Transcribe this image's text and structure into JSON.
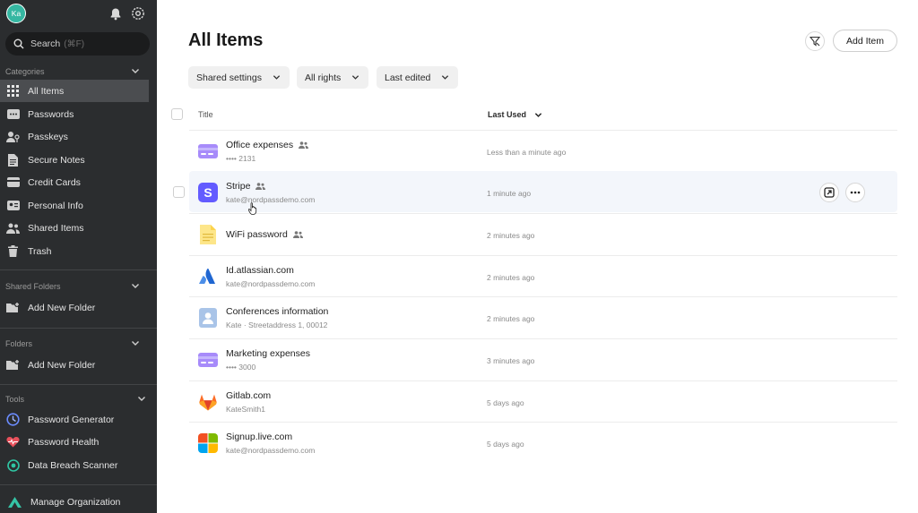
{
  "user": {
    "initials": "Ka"
  },
  "search": {
    "label": "Search",
    "shortcut": "(⌘F)"
  },
  "categories": {
    "heading": "Categories",
    "items": [
      {
        "label": "All Items",
        "icon": "grid-icon",
        "active": true
      },
      {
        "label": "Passwords",
        "icon": "password-icon"
      },
      {
        "label": "Passkeys",
        "icon": "passkey-icon"
      },
      {
        "label": "Secure Notes",
        "icon": "note-icon"
      },
      {
        "label": "Credit Cards",
        "icon": "card-icon"
      },
      {
        "label": "Personal Info",
        "icon": "id-card-icon"
      },
      {
        "label": "Shared Items",
        "icon": "users-icon"
      },
      {
        "label": "Trash",
        "icon": "trash-icon"
      }
    ]
  },
  "shared_folders": {
    "heading": "Shared Folders",
    "add_label": "Add New Folder"
  },
  "folders": {
    "heading": "Folders",
    "add_label": "Add New Folder"
  },
  "tools": {
    "heading": "Tools",
    "items": [
      {
        "label": "Password Generator",
        "icon": "generator-icon"
      },
      {
        "label": "Password Health",
        "icon": "heart-pulse-icon"
      },
      {
        "label": "Data Breach Scanner",
        "icon": "breach-scanner-icon"
      }
    ]
  },
  "manage_org": {
    "label": "Manage Organization"
  },
  "main": {
    "title": "All Items",
    "add_item_label": "Add Item",
    "filters": {
      "shared": "Shared settings",
      "rights": "All rights",
      "sort": "Last edited"
    },
    "columns": {
      "title": "Title",
      "last_used": "Last Used"
    }
  },
  "items": [
    {
      "title": "Office expenses",
      "subtitle": "•••• 2131",
      "time": "Less than a minute ago",
      "shared": true,
      "icon": "credit-card-icon"
    },
    {
      "title": "Stripe",
      "subtitle": "kate@nordpassdemo.com",
      "time": "1 minute ago",
      "shared": true,
      "icon": "stripe-logo-icon"
    },
    {
      "title": "WiFi password",
      "subtitle": "",
      "time": "2 minutes ago",
      "shared": true,
      "icon": "secure-note-icon"
    },
    {
      "title": "Id.atlassian.com",
      "subtitle": "kate@nordpassdemo.com",
      "time": "2 minutes ago",
      "shared": false,
      "icon": "atlassian-logo-icon"
    },
    {
      "title": "Conferences information",
      "subtitle": "Kate · Streetaddress 1, 00012",
      "time": "2 minutes ago",
      "shared": false,
      "icon": "personal-info-icon"
    },
    {
      "title": "Marketing expenses",
      "subtitle": "•••• 3000",
      "time": "3 minutes ago",
      "shared": false,
      "icon": "credit-card-icon"
    },
    {
      "title": "Gitlab.com",
      "subtitle": "KateSmith1",
      "time": "5 days ago",
      "shared": false,
      "icon": "gitlab-logo-icon"
    },
    {
      "title": "Signup.live.com",
      "subtitle": "kate@nordpassdemo.com",
      "time": "5 days ago",
      "shared": false,
      "icon": "microsoft-logo-icon"
    }
  ],
  "colors": {
    "sidebar_bg": "#2b2d2f",
    "active_bg": "#4b4d50",
    "avatar": "#35b7a2",
    "card_purple": "#a78bfa",
    "stripe": "#635bff"
  }
}
